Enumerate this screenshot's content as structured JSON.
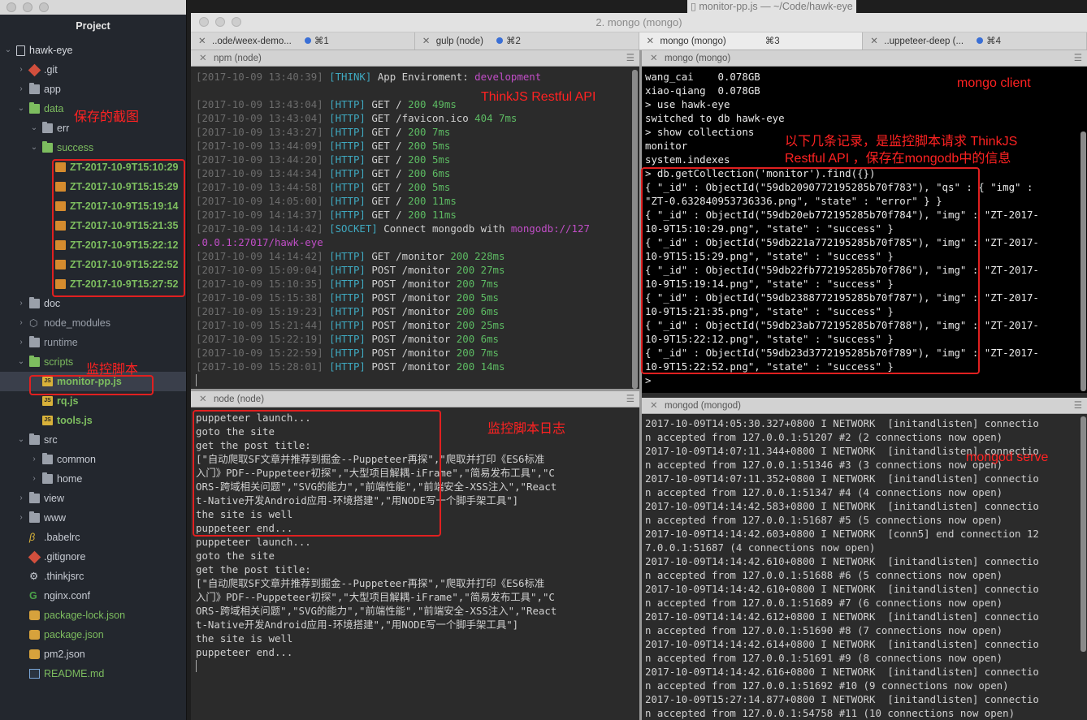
{
  "window_title": "monitor-pp.js — ~/Code/hawk-eye",
  "sidebar": {
    "title": "Project",
    "root": "hawk-eye",
    "items": [
      {
        "label": ".git",
        "icon": "git-icon",
        "indent": 1,
        "chev": "›"
      },
      {
        "label": "app",
        "icon": "folder-icon",
        "indent": 1,
        "chev": "›"
      },
      {
        "label": "data",
        "icon": "folder-icon",
        "indent": 1,
        "chev": "⌄",
        "green": true
      },
      {
        "label": "err",
        "icon": "folder-icon",
        "indent": 2,
        "chev": "⌄"
      },
      {
        "label": "success",
        "icon": "folder-icon",
        "indent": 2,
        "chev": "⌄",
        "green": true
      },
      {
        "label": "ZT-2017-10-9T15:10:29",
        "icon": "image-icon",
        "indent": 3,
        "green": true
      },
      {
        "label": "ZT-2017-10-9T15:15:29",
        "icon": "image-icon",
        "indent": 3,
        "green": true
      },
      {
        "label": "ZT-2017-10-9T15:19:14",
        "icon": "image-icon",
        "indent": 3,
        "green": true
      },
      {
        "label": "ZT-2017-10-9T15:21:35",
        "icon": "image-icon",
        "indent": 3,
        "green": true
      },
      {
        "label": "ZT-2017-10-9T15:22:12",
        "icon": "image-icon",
        "indent": 3,
        "green": true
      },
      {
        "label": "ZT-2017-10-9T15:22:52",
        "icon": "image-icon",
        "indent": 3,
        "green": true
      },
      {
        "label": "ZT-2017-10-9T15:27:52",
        "icon": "image-icon",
        "indent": 3,
        "green": true
      },
      {
        "label": "doc",
        "icon": "folder-icon",
        "indent": 1,
        "chev": "›"
      },
      {
        "label": "node_modules",
        "icon": "node-icon",
        "indent": 1,
        "chev": "›",
        "dim": true
      },
      {
        "label": "runtime",
        "icon": "folder-icon",
        "indent": 1,
        "chev": "›",
        "dim": true
      },
      {
        "label": "scripts",
        "icon": "folder-icon",
        "indent": 1,
        "chev": "⌄",
        "green": true
      },
      {
        "label": "monitor-pp.js",
        "icon": "js-icon",
        "indent": 2,
        "green": true,
        "selected": true
      },
      {
        "label": "rq.js",
        "icon": "js-icon",
        "indent": 2,
        "green": true
      },
      {
        "label": "tools.js",
        "icon": "js-icon",
        "indent": 2,
        "green": true
      },
      {
        "label": "src",
        "icon": "folder-icon",
        "indent": 1,
        "chev": "⌄"
      },
      {
        "label": "common",
        "icon": "folder-icon",
        "indent": 2,
        "chev": "›"
      },
      {
        "label": "home",
        "icon": "folder-icon",
        "indent": 2,
        "chev": "›"
      },
      {
        "label": "view",
        "icon": "folder-icon",
        "indent": 1,
        "chev": "›"
      },
      {
        "label": "www",
        "icon": "folder-icon",
        "indent": 1,
        "chev": "›"
      },
      {
        "label": ".babelrc",
        "icon": "babel-icon",
        "indent": 1
      },
      {
        "label": ".gitignore",
        "icon": "git-icon",
        "indent": 1
      },
      {
        "label": ".thinkjsrc",
        "icon": "gear-icon",
        "indent": 1
      },
      {
        "label": "nginx.conf",
        "icon": "nginx-icon",
        "indent": 1
      },
      {
        "label": "package-lock.json",
        "icon": "db-icon",
        "indent": 1,
        "green": true
      },
      {
        "label": "package.json",
        "icon": "db-icon",
        "indent": 1,
        "green": true
      },
      {
        "label": "pm2.json",
        "icon": "db-icon",
        "indent": 1
      },
      {
        "label": "README.md",
        "icon": "doc-icon",
        "indent": 1,
        "green": true
      }
    ]
  },
  "annotations": {
    "screenshots": "保存的截图",
    "monitor_script": "监控脚本",
    "thinkjs_api": "ThinkJS Restful API",
    "mongo_client": "mongo client",
    "records_note_1": "以下几条记录，是监控脚本请求 ThinkJS",
    "records_note_2": "Restful API ，保存在mongodb中的信息",
    "script_log": "监控脚本日志",
    "mongod_serve": "mongod serve"
  },
  "terminal": {
    "title": "2. mongo (mongo)",
    "tabs": [
      {
        "label": "..ode/weex-demo...",
        "shortcut": "⌘1"
      },
      {
        "label": "gulp (node)",
        "shortcut": "⌘2"
      },
      {
        "label": "mongo (mongo)",
        "shortcut": "⌘3",
        "active": true
      },
      {
        "label": "..uppeteer-deep (...",
        "shortcut": "⌘4"
      }
    ],
    "panes": {
      "npm": {
        "title": "npm (node)",
        "lines": [
          [
            [
              "[2017-10-09 13:40:39] ",
              "gray"
            ],
            [
              "[THINK] ",
              "cyan"
            ],
            [
              "App Enviroment: ",
              "white"
            ],
            [
              "development",
              "magenta"
            ]
          ],
          [],
          [
            [
              "[2017-10-09 13:43:04] ",
              "gray"
            ],
            [
              "[HTTP] ",
              "cyan"
            ],
            [
              "GET / ",
              "white"
            ],
            [
              "200 ",
              "green"
            ],
            [
              "49ms",
              "green"
            ]
          ],
          [
            [
              "[2017-10-09 13:43:04] ",
              "gray"
            ],
            [
              "[HTTP] ",
              "cyan"
            ],
            [
              "GET /favicon.ico ",
              "white"
            ],
            [
              "404 ",
              "green"
            ],
            [
              "7ms",
              "green"
            ]
          ],
          [
            [
              "[2017-10-09 13:43:27] ",
              "gray"
            ],
            [
              "[HTTP] ",
              "cyan"
            ],
            [
              "GET / ",
              "white"
            ],
            [
              "200 ",
              "green"
            ],
            [
              "7ms",
              "green"
            ]
          ],
          [
            [
              "[2017-10-09 13:44:09] ",
              "gray"
            ],
            [
              "[HTTP] ",
              "cyan"
            ],
            [
              "GET / ",
              "white"
            ],
            [
              "200 ",
              "green"
            ],
            [
              "5ms",
              "green"
            ]
          ],
          [
            [
              "[2017-10-09 13:44:20] ",
              "gray"
            ],
            [
              "[HTTP] ",
              "cyan"
            ],
            [
              "GET / ",
              "white"
            ],
            [
              "200 ",
              "green"
            ],
            [
              "5ms",
              "green"
            ]
          ],
          [
            [
              "[2017-10-09 13:44:34] ",
              "gray"
            ],
            [
              "[HTTP] ",
              "cyan"
            ],
            [
              "GET / ",
              "white"
            ],
            [
              "200 ",
              "green"
            ],
            [
              "6ms",
              "green"
            ]
          ],
          [
            [
              "[2017-10-09 13:44:58] ",
              "gray"
            ],
            [
              "[HTTP] ",
              "cyan"
            ],
            [
              "GET / ",
              "white"
            ],
            [
              "200 ",
              "green"
            ],
            [
              "5ms",
              "green"
            ]
          ],
          [
            [
              "[2017-10-09 14:05:00] ",
              "gray"
            ],
            [
              "[HTTP] ",
              "cyan"
            ],
            [
              "GET / ",
              "white"
            ],
            [
              "200 ",
              "green"
            ],
            [
              "11ms",
              "green"
            ]
          ],
          [
            [
              "[2017-10-09 14:14:37] ",
              "gray"
            ],
            [
              "[HTTP] ",
              "cyan"
            ],
            [
              "GET / ",
              "white"
            ],
            [
              "200 ",
              "green"
            ],
            [
              "11ms",
              "green"
            ]
          ],
          [
            [
              "[2017-10-09 14:14:42] ",
              "gray"
            ],
            [
              "[SOCKET] ",
              "cyan"
            ],
            [
              "Connect mongodb with ",
              "white"
            ],
            [
              "mongodb://127",
              "magenta"
            ]
          ],
          [
            [
              ".0.0.1:27017/hawk-eye",
              "magenta"
            ]
          ],
          [
            [
              "[2017-10-09 14:14:42] ",
              "gray"
            ],
            [
              "[HTTP] ",
              "cyan"
            ],
            [
              "GET /monitor ",
              "white"
            ],
            [
              "200 ",
              "green"
            ],
            [
              "228ms",
              "green"
            ]
          ],
          [
            [
              "[2017-10-09 15:09:04] ",
              "gray"
            ],
            [
              "[HTTP] ",
              "cyan"
            ],
            [
              "POST /monitor ",
              "white"
            ],
            [
              "200 ",
              "green"
            ],
            [
              "27ms",
              "green"
            ]
          ],
          [
            [
              "[2017-10-09 15:10:35] ",
              "gray"
            ],
            [
              "[HTTP] ",
              "cyan"
            ],
            [
              "POST /monitor ",
              "white"
            ],
            [
              "200 ",
              "green"
            ],
            [
              "7ms",
              "green"
            ]
          ],
          [
            [
              "[2017-10-09 15:15:38] ",
              "gray"
            ],
            [
              "[HTTP] ",
              "cyan"
            ],
            [
              "POST /monitor ",
              "white"
            ],
            [
              "200 ",
              "green"
            ],
            [
              "5ms",
              "green"
            ]
          ],
          [
            [
              "[2017-10-09 15:19:23] ",
              "gray"
            ],
            [
              "[HTTP] ",
              "cyan"
            ],
            [
              "POST /monitor ",
              "white"
            ],
            [
              "200 ",
              "green"
            ],
            [
              "6ms",
              "green"
            ]
          ],
          [
            [
              "[2017-10-09 15:21:44] ",
              "gray"
            ],
            [
              "[HTTP] ",
              "cyan"
            ],
            [
              "POST /monitor ",
              "white"
            ],
            [
              "200 ",
              "green"
            ],
            [
              "25ms",
              "green"
            ]
          ],
          [
            [
              "[2017-10-09 15:22:19] ",
              "gray"
            ],
            [
              "[HTTP] ",
              "cyan"
            ],
            [
              "POST /monitor ",
              "white"
            ],
            [
              "200 ",
              "green"
            ],
            [
              "6ms",
              "green"
            ]
          ],
          [
            [
              "[2017-10-09 15:22:59] ",
              "gray"
            ],
            [
              "[HTTP] ",
              "cyan"
            ],
            [
              "POST /monitor ",
              "white"
            ],
            [
              "200 ",
              "green"
            ],
            [
              "7ms",
              "green"
            ]
          ],
          [
            [
              "[2017-10-09 15:28:01] ",
              "gray"
            ],
            [
              "[HTTP] ",
              "cyan"
            ],
            [
              "POST /monitor ",
              "white"
            ],
            [
              "200 ",
              "green"
            ],
            [
              "14ms",
              "green"
            ]
          ]
        ]
      },
      "node": {
        "title": "node (node)",
        "lines": [
          "puppeteer launch...",
          "goto the site",
          "get the post title:",
          "[\"自动爬取SF文章并推荐到掘金--Puppeteer再探\",\"爬取并打印《ES6标准",
          "入门》PDF--Puppeteer初探\",\"大型项目解耦-iFrame\",\"简易发布工具\",\"C",
          "ORS-跨域相关问题\",\"SVG的能力\",\"前端性能\",\"前端安全-XSS注入\",\"React",
          "t-Native开发Android应用-环境搭建\",\"用NODE写一个脚手架工具\"]",
          "the site is well",
          "puppeteer end...",
          "puppeteer launch...",
          "goto the site",
          "get the post title:",
          "[\"自动爬取SF文章并推荐到掘金--Puppeteer再探\",\"爬取并打印《ES6标准",
          "入门》PDF--Puppeteer初探\",\"大型项目解耦-iFrame\",\"简易发布工具\",\"C",
          "ORS-跨域相关问题\",\"SVG的能力\",\"前端性能\",\"前端安全-XSS注入\",\"React",
          "t-Native开发Android应用-环境搭建\",\"用NODE写一个脚手架工具\"]",
          "the site is well",
          "puppeteer end..."
        ]
      },
      "mongo": {
        "title": "mongo (mongo)",
        "lines": [
          "wang_cai    0.078GB",
          "xiao-qiang  0.078GB",
          "> use hawk-eye",
          "switched to db hawk-eye",
          "> show collections",
          "monitor",
          "system.indexes",
          "> db.getCollection('monitor').find({})",
          "{ \"_id\" : ObjectId(\"59db2090772195285b70f783\"), \"qs\" : { \"img\" :",
          "\"ZT-0.632840953736336.png\", \"state\" : \"error\" } }",
          "{ \"_id\" : ObjectId(\"59db20eb772195285b70f784\"), \"img\" : \"ZT-2017-",
          "10-9T15:10:29.png\", \"state\" : \"success\" }",
          "{ \"_id\" : ObjectId(\"59db221a772195285b70f785\"), \"img\" : \"ZT-2017-",
          "10-9T15:15:29.png\", \"state\" : \"success\" }",
          "{ \"_id\" : ObjectId(\"59db22fb772195285b70f786\"), \"img\" : \"ZT-2017-",
          "10-9T15:19:14.png\", \"state\" : \"success\" }",
          "{ \"_id\" : ObjectId(\"59db2388772195285b70f787\"), \"img\" : \"ZT-2017-",
          "10-9T15:21:35.png\", \"state\" : \"success\" }",
          "{ \"_id\" : ObjectId(\"59db23ab772195285b70f788\"), \"img\" : \"ZT-2017-",
          "10-9T15:22:12.png\", \"state\" : \"success\" }",
          "{ \"_id\" : ObjectId(\"59db23d3772195285b70f789\"), \"img\" : \"ZT-2017-",
          "10-9T15:22:52.png\", \"state\" : \"success\" }",
          "> "
        ]
      },
      "mongod": {
        "title": "mongod (mongod)",
        "lines": [
          "2017-10-09T14:05:30.327+0800 I NETWORK  [initandlisten] connectio",
          "n accepted from 127.0.0.1:51207 #2 (2 connections now open)",
          "2017-10-09T14:07:11.344+0800 I NETWORK  [initandlisten] connectio",
          "n accepted from 127.0.0.1:51346 #3 (3 connections now open)",
          "2017-10-09T14:07:11.352+0800 I NETWORK  [initandlisten] connectio",
          "n accepted from 127.0.0.1:51347 #4 (4 connections now open)",
          "2017-10-09T14:14:42.583+0800 I NETWORK  [initandlisten] connectio",
          "n accepted from 127.0.0.1:51687 #5 (5 connections now open)",
          "2017-10-09T14:14:42.603+0800 I NETWORK  [conn5] end connection 12",
          "7.0.0.1:51687 (4 connections now open)",
          "2017-10-09T14:14:42.610+0800 I NETWORK  [initandlisten] connectio",
          "n accepted from 127.0.0.1:51688 #6 (5 connections now open)",
          "2017-10-09T14:14:42.610+0800 I NETWORK  [initandlisten] connectio",
          "n accepted from 127.0.0.1:51689 #7 (6 connections now open)",
          "2017-10-09T14:14:42.612+0800 I NETWORK  [initandlisten] connectio",
          "n accepted from 127.0.0.1:51690 #8 (7 connections now open)",
          "2017-10-09T14:14:42.614+0800 I NETWORK  [initandlisten] connectio",
          "n accepted from 127.0.0.1:51691 #9 (8 connections now open)",
          "2017-10-09T14:14:42.616+0800 I NETWORK  [initandlisten] connectio",
          "n accepted from 127.0.0.1:51692 #10 (9 connections now open)",
          "2017-10-09T15:27:14.877+0800 I NETWORK  [initandlisten] connectio",
          "n accepted from 127.0.0.1:54758 #11 (10 connections now open)"
        ]
      }
    }
  }
}
